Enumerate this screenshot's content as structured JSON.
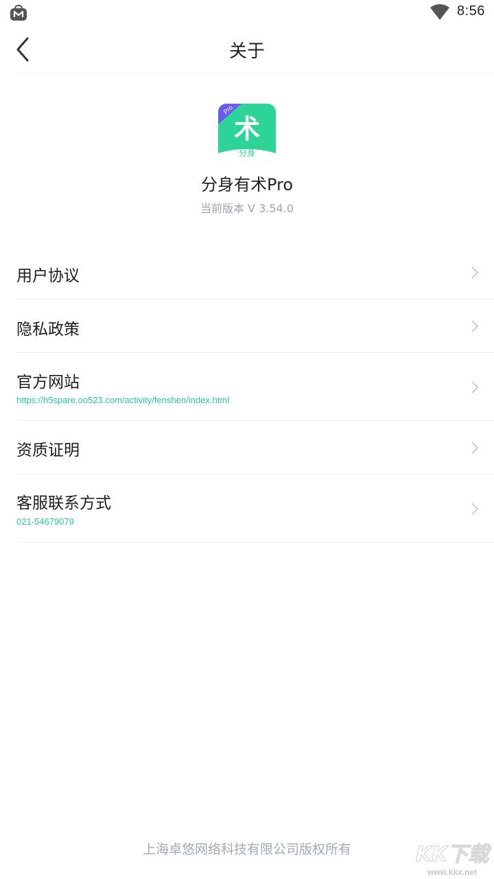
{
  "status_bar": {
    "time": "8:56",
    "app_icon": "shopping-bag-icon",
    "wifi_icon": "wifi-icon"
  },
  "header": {
    "title": "关于",
    "back_icon": "chevron-left-icon"
  },
  "app": {
    "logo_icon": "app-logo-icon",
    "logo_badge": "Pro",
    "logo_char": "术",
    "logo_caption": "分身",
    "name": "分身有术Pro",
    "version": "当前版本 V 3.54.0"
  },
  "menu": {
    "items": [
      {
        "label": "用户协议",
        "sub": ""
      },
      {
        "label": "隐私政策",
        "sub": ""
      },
      {
        "label": "官方网站",
        "sub": "https://h5spare.oo523.com/activity/fenshen/index.html"
      },
      {
        "label": "资质证明",
        "sub": ""
      },
      {
        "label": "客服联系方式",
        "sub": "021-54679079"
      }
    ]
  },
  "footer": {
    "copyright": "上海卓悠网络科技有限公司版权所有"
  },
  "watermark": {
    "brand": "KK下载",
    "url": "www.kkx.net"
  },
  "colors": {
    "accent": "#2fc59a",
    "logo_green": "#2dd497",
    "logo_badge": "#6a5cf0",
    "muted": "#a0a4ab",
    "divider": "#eeeeee"
  }
}
